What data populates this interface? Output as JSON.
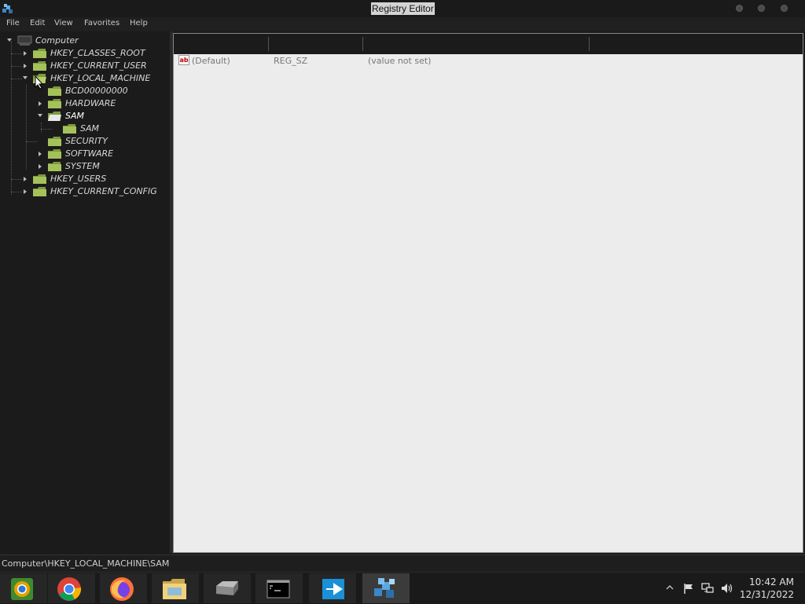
{
  "window": {
    "title": "Registry Editor",
    "menu": [
      "File",
      "Edit",
      "View",
      "Favorites",
      "Help"
    ]
  },
  "tree": {
    "root": "Computer",
    "hives": {
      "classes_root": "HKEY_CLASSES_ROOT",
      "current_user": "HKEY_CURRENT_USER",
      "local_machine": "HKEY_LOCAL_MACHINE",
      "users": "HKEY_USERS",
      "current_config": "HKEY_CURRENT_CONFIG"
    },
    "hklm_children": {
      "bcd": "BCD00000000",
      "hardware": "HARDWARE",
      "sam": "SAM",
      "sam_child": "SAM",
      "security": "SECURITY",
      "software": "SOFTWARE",
      "system": "SYSTEM"
    }
  },
  "values": {
    "rows": [
      {
        "name": "(Default)",
        "type": "REG_SZ",
        "data": "(value not set)"
      }
    ]
  },
  "statusbar": {
    "path": "Computer\\HKEY_LOCAL_MACHINE\\SAM"
  },
  "taskbar": {
    "apps": [
      "chromium-icon",
      "chrome-icon",
      "firefox-icon",
      "file-manager-icon",
      "disk-utility-icon",
      "terminal-icon",
      "remote-desktop-icon",
      "registry-editor-icon"
    ],
    "clock": {
      "time": "10:42 AM",
      "date": "12/31/2022"
    }
  },
  "colors": {
    "folder": "#9ab850",
    "pane_bg": "#ececec",
    "dark_bg": "#1b1b1b"
  }
}
